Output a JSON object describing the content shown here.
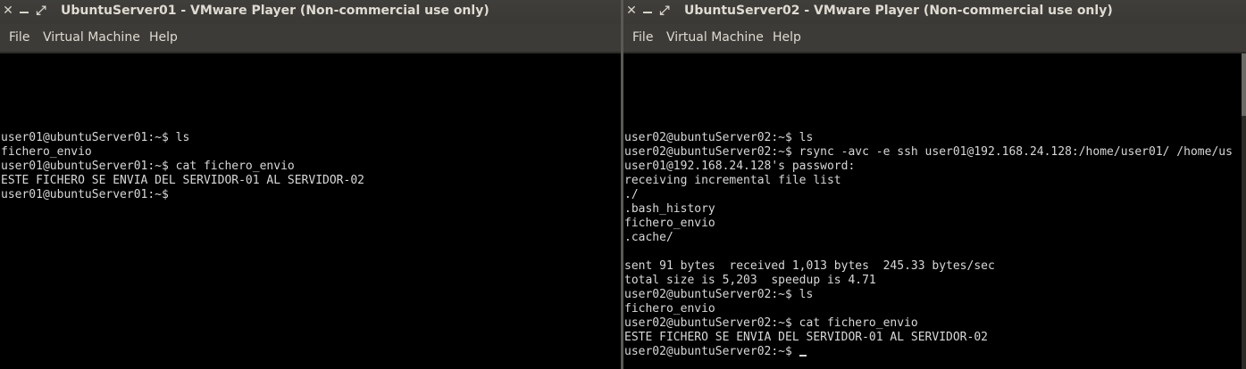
{
  "window1": {
    "title": "UbuntuServer01 - VMware Player (Non-commercial use only)",
    "menu": [
      "File",
      "Virtual Machine",
      "Help"
    ],
    "console_lines": [
      "user01@ubuntuServer01:~$ ls",
      "fichero_envio",
      "user01@ubuntuServer01:~$ cat fichero_envio",
      "ESTE FICHERO SE ENVIA DEL SERVIDOR-01 AL SERVIDOR-02",
      "user01@ubuntuServer01:~$"
    ]
  },
  "window2": {
    "title": "UbuntuServer02 - VMware Player (Non-commercial use only)",
    "menu": [
      "File",
      "Virtual Machine",
      "Help"
    ],
    "console_lines": [
      "user02@ubuntuServer02:~$ ls",
      "user02@ubuntuServer02:~$ rsync -avc -e ssh user01@192.168.24.128:/home/user01/ /home/us",
      "user01@192.168.24.128's password:",
      "receiving incremental file list",
      "./",
      ".bash_history",
      "fichero_envio",
      ".cache/",
      "",
      "sent 91 bytes  received 1,013 bytes  245.33 bytes/sec",
      "total size is 5,203  speedup is 4.71",
      "user02@ubuntuServer02:~$ ls",
      "fichero_envio",
      "user02@ubuntuServer02:~$ cat fichero_envio",
      "ESTE FICHERO SE ENVIA DEL SERVIDOR-01 AL SERVIDOR-02",
      "user02@ubuntuServer02:~$ "
    ]
  },
  "icons": {
    "close": "close-icon",
    "minimize": "minimize-icon",
    "maximize": "maximize-icon"
  }
}
